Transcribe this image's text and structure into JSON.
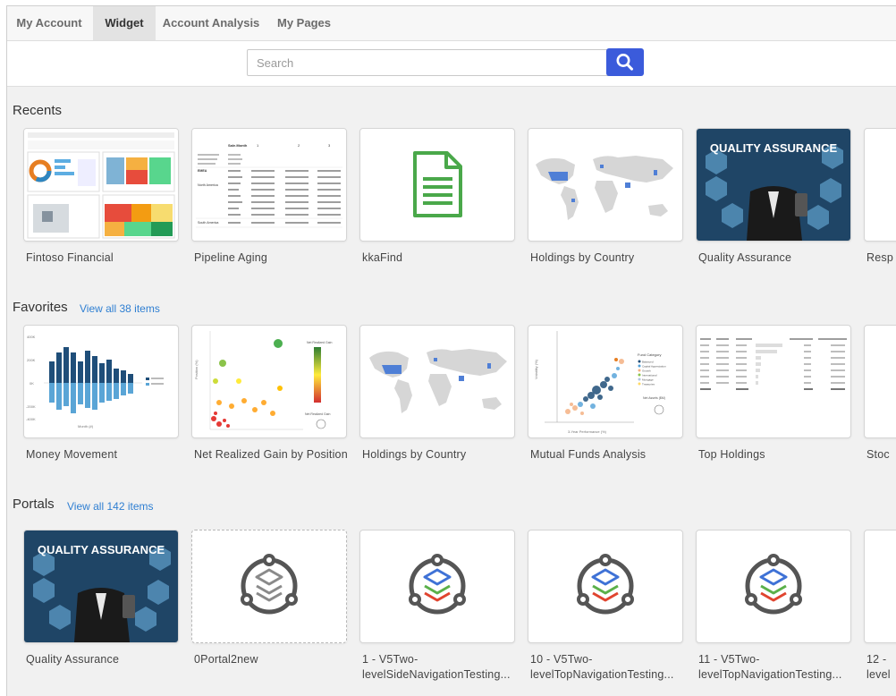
{
  "tabs": [
    "My Account",
    "Widget",
    "Account Analysis",
    "My Pages"
  ],
  "search": {
    "placeholder": "Search"
  },
  "recents": {
    "title": "Recents",
    "items": [
      "Fintoso Financial",
      "Pipeline Aging",
      "kkaFind",
      "Holdings by Country",
      "Quality Assurance",
      "Resp"
    ]
  },
  "favorites": {
    "title": "Favorites",
    "view_all": "View all 38 items",
    "items": [
      "Money Movement",
      "Net Realized Gain by Position",
      "Holdings by Country",
      "Mutual Funds Analysis",
      "Top Holdings",
      "Stoc"
    ]
  },
  "portals": {
    "title": "Portals",
    "view_all": "View all 142 items",
    "items": [
      {
        "line1": "Quality Assurance",
        "line2": ""
      },
      {
        "line1": "0Portal2new",
        "line2": ""
      },
      {
        "line1": "1 - V5Two-",
        "line2": "levelSideNavigationTesting..."
      },
      {
        "line1": "10 - V5Two-",
        "line2": "levelTopNavigationTesting..."
      },
      {
        "line1": "11 - V5Two-",
        "line2": "levelTopNavigationTesting..."
      },
      {
        "line1": "12 -",
        "line2": "level"
      }
    ]
  },
  "thumb_text": {
    "qa": "QUALITY ASSURANCE",
    "pipeline_headers": [
      "Sale.Month",
      "1",
      "2",
      "3"
    ],
    "pipeline_rows": [
      "EMEA",
      "North America",
      "South America"
    ],
    "money_axis": [
      "400K",
      "200K",
      "0K",
      "-200K",
      "-400K"
    ],
    "money_x": "Month (#)",
    "gain_legend": "Net Realized Gain",
    "gain_size": "Net Realized Gain",
    "gain_xlabel": "Net Realized Gain",
    "funds_legend_title": "Fund Category",
    "funds_legend": [
      "Balanced",
      "Capital Appreciation",
      "Growth",
      "International",
      "Mortgage",
      "Treasuries"
    ],
    "funds_size": "Net Assets ($M)",
    "funds_x": "3-Year Performance (%)",
    "funds_y": "Volatility (%)",
    "gain_y": "Position (%)"
  },
  "colors": {
    "accent": "#3b5bdb",
    "link": "#2f7fd2",
    "doc_green": "#4aa84a",
    "map_blue": "#4f7fd6"
  }
}
